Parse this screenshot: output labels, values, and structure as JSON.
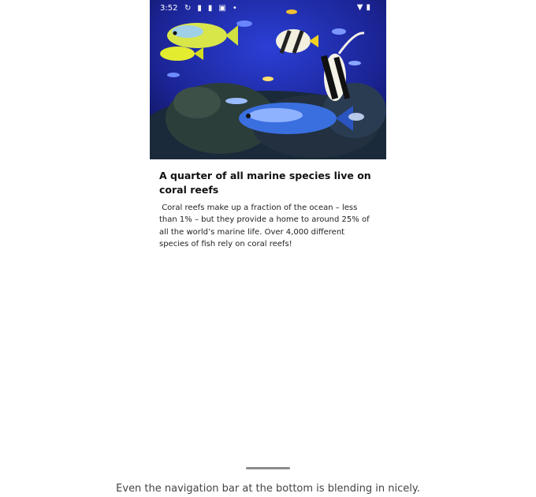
{
  "status_bar": {
    "time": "3:52",
    "left_icons": [
      "sync-icon",
      "notification-icon",
      "notification-icon",
      "media-icon",
      "dot-icon"
    ],
    "right_icons": [
      "wifi-icon",
      "battery-icon"
    ]
  },
  "hero": {
    "icon": "coral-reef-fish-image"
  },
  "article": {
    "headline": "A quarter of all marine species live on coral reefs",
    "body": " Coral reefs make up a fraction of the ocean – less than 1% – but they provide a home to around 25% of all the world’s marine life. Over 4,000 different species of fish rely on coral reefs!"
  },
  "caption": "Even the navigation bar at the bottom is blending in nicely.",
  "colors": {
    "ocean": "#1d2aa8",
    "text": "#111111"
  }
}
